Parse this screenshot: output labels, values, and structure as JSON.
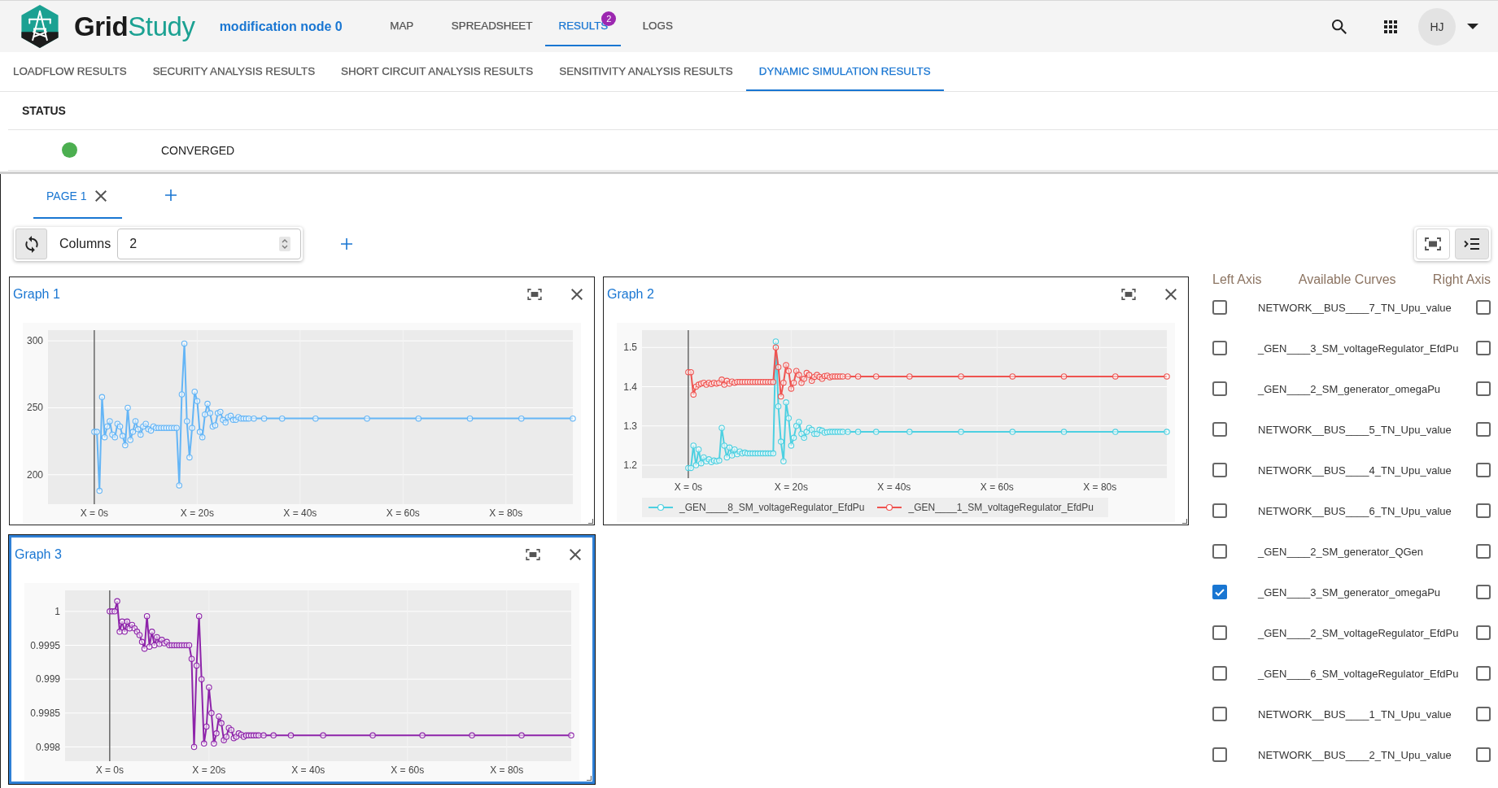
{
  "header": {
    "app_title": [
      "Grid",
      "Study"
    ],
    "study_name": "modification node 0",
    "nav_tabs": [
      {
        "label": "MAP",
        "selected": false
      },
      {
        "label": "SPREADSHEET",
        "selected": false
      },
      {
        "label": "RESULTS",
        "selected": true,
        "badge": "2"
      },
      {
        "label": "LOGS",
        "selected": false
      }
    ],
    "user_initials": "HJ"
  },
  "result_tabs": [
    {
      "label": "LOADFLOW RESULTS",
      "selected": false
    },
    {
      "label": "SECURITY ANALYSIS RESULTS",
      "selected": false
    },
    {
      "label": "SHORT CIRCUIT ANALYSIS RESULTS",
      "selected": false
    },
    {
      "label": "SENSITIVITY ANALYSIS RESULTS",
      "selected": false
    },
    {
      "label": "DYNAMIC SIMULATION RESULTS",
      "selected": true
    }
  ],
  "status_table": {
    "columns": [
      "STATUS"
    ],
    "rows": [
      {
        "color": "#4caf50",
        "status": "CONVERGED"
      }
    ]
  },
  "page_tabs": [
    {
      "label": "PAGE 1",
      "selected": true
    }
  ],
  "toolbar": {
    "columns_label": "Columns",
    "columns_value": "2"
  },
  "view_toggles": [
    {
      "kind": "fullscreen",
      "selected": false
    },
    {
      "kind": "curves",
      "selected": true
    }
  ],
  "graphs": [
    {
      "title": "Graph 1",
      "selected": false,
      "chart_data": {
        "type": "line",
        "grid": true,
        "x": [
          0,
          0.5,
          1,
          1.5,
          2,
          2.5,
          3,
          3.5,
          4,
          4.5,
          5,
          5.5,
          6,
          6.5,
          7,
          7.5,
          8,
          8.5,
          9,
          9.5,
          10,
          10.5,
          11,
          11.5,
          12,
          12.5,
          13,
          13.5,
          14,
          14.5,
          15,
          15.5,
          16,
          16.5,
          17,
          17.5,
          18,
          18.5,
          19,
          19.5,
          20,
          20.5,
          21,
          21.5,
          22,
          22.5,
          23,
          23.5,
          24,
          24.5,
          25,
          25.5,
          26,
          26.5,
          27,
          27.5,
          28,
          28.5,
          29,
          29.5,
          30,
          31,
          33,
          36.5,
          43,
          53,
          63,
          73,
          83,
          93
        ],
        "xlim": [
          -9,
          93
        ],
        "ylim": [
          178,
          308
        ],
        "xticks": [
          {
            "value": 0,
            "label": "X = 0s"
          },
          {
            "value": 20,
            "label": "X = 20s"
          },
          {
            "value": 40,
            "label": "X = 40s"
          },
          {
            "value": 60,
            "label": "X = 60s"
          },
          {
            "value": 80,
            "label": "X = 80s"
          }
        ],
        "yticks": [
          200,
          250,
          300
        ],
        "series": [
          {
            "color": "#64b5f6",
            "marker": "circle",
            "values": [
              232,
              232,
              188,
              258,
              228,
              236,
              240,
              230,
              228,
              238,
              236,
              229,
              222,
              250,
              226,
              232,
              240,
              234,
              230,
              236,
              238,
              234,
              233,
              236,
              235,
              235,
              235,
              235,
              235,
              235,
              235,
              235,
              235,
              192,
              260,
              298,
              240,
              213,
              235,
              262,
              255,
              232,
              228,
              245,
              253,
              246,
              236,
              237,
              246,
              247,
              241,
              239,
              243,
              244,
              241,
              241,
              243,
              242,
              242,
              242,
              242,
              242,
              242,
              242,
              242,
              242,
              242,
              242,
              242,
              242
            ]
          }
        ]
      }
    },
    {
      "title": "Graph 2",
      "selected": false,
      "chart_data": {
        "type": "line",
        "grid": true,
        "legend": "bottom",
        "x": [
          0,
          0.5,
          1,
          1.5,
          2,
          2.5,
          3,
          3.5,
          4,
          4.5,
          5,
          5.5,
          6,
          6.5,
          7,
          7.5,
          8,
          8.5,
          9,
          9.5,
          10,
          10.5,
          11,
          11.5,
          12,
          12.5,
          13,
          13.5,
          14,
          14.5,
          15,
          15.5,
          16,
          16.5,
          17,
          17.5,
          18,
          18.5,
          19,
          19.5,
          20,
          20.5,
          21,
          21.5,
          22,
          22.5,
          23,
          23.5,
          24,
          24.5,
          25,
          25.5,
          26,
          26.5,
          27,
          27.5,
          28,
          28.5,
          29,
          29.5,
          30,
          31,
          33,
          36.5,
          43,
          53,
          63,
          73,
          83,
          93
        ],
        "xlim": [
          -9,
          93
        ],
        "ylim": [
          1.167,
          1.544
        ],
        "xticks": [
          {
            "value": 0,
            "label": "X = 0s"
          },
          {
            "value": 20,
            "label": "X = 20s"
          },
          {
            "value": 40,
            "label": "X = 40s"
          },
          {
            "value": 60,
            "label": "X = 60s"
          },
          {
            "value": 80,
            "label": "X = 80s"
          }
        ],
        "yticks": [
          1.2,
          1.3,
          1.4,
          1.5
        ],
        "series": [
          {
            "name": "_GEN____8_SM_voltageRegulator_EfdPu",
            "color": "#4dd0e1",
            "marker": "circle",
            "values": [
              1.193,
              1.193,
              1.25,
              1.2,
              1.24,
              1.205,
              1.22,
              1.21,
              1.215,
              1.208,
              1.212,
              1.21,
              1.212,
              1.295,
              1.25,
              1.22,
              1.245,
              1.225,
              1.24,
              1.228,
              1.235,
              1.23,
              1.232,
              1.23,
              1.23,
              1.23,
              1.23,
              1.23,
              1.23,
              1.23,
              1.23,
              1.23,
              1.23,
              1.23,
              1.515,
              1.35,
              1.26,
              1.21,
              1.36,
              1.32,
              1.25,
              1.27,
              1.3,
              1.31,
              1.28,
              1.27,
              1.285,
              1.295,
              1.29,
              1.28,
              1.28,
              1.29,
              1.288,
              1.283,
              1.284,
              1.285,
              1.285,
              1.285,
              1.285,
              1.285,
              1.285,
              1.285,
              1.285,
              1.285,
              1.285,
              1.285,
              1.285,
              1.285,
              1.285,
              1.285
            ]
          },
          {
            "name": "_GEN____1_SM_voltageRegulator_EfdPu",
            "color": "#ef5350",
            "marker": "circle",
            "values": [
              1.437,
              1.437,
              1.38,
              1.4,
              1.405,
              1.408,
              1.41,
              1.405,
              1.41,
              1.407,
              1.41,
              1.408,
              1.41,
              1.418,
              1.405,
              1.415,
              1.408,
              1.413,
              1.41,
              1.412,
              1.412,
              1.412,
              1.412,
              1.412,
              1.412,
              1.412,
              1.412,
              1.412,
              1.412,
              1.412,
              1.412,
              1.412,
              1.412,
              1.412,
              1.5,
              1.45,
              1.375,
              1.41,
              1.455,
              1.44,
              1.395,
              1.41,
              1.44,
              1.43,
              1.41,
              1.42,
              1.435,
              1.43,
              1.415,
              1.425,
              1.43,
              1.425,
              1.42,
              1.427,
              1.428,
              1.424,
              1.426,
              1.426,
              1.426,
              1.426,
              1.426,
              1.426,
              1.426,
              1.426,
              1.426,
              1.426,
              1.426,
              1.426,
              1.426,
              1.426
            ]
          }
        ]
      }
    },
    {
      "title": "Graph 3",
      "selected": true,
      "chart_data": {
        "type": "line",
        "grid": true,
        "x": [
          0,
          0.5,
          1,
          1.5,
          2,
          2.5,
          3,
          3.5,
          4,
          4.5,
          5,
          5.5,
          6,
          6.5,
          7,
          7.5,
          8,
          8.5,
          9,
          9.5,
          10,
          10.5,
          11,
          11.5,
          12,
          12.5,
          13,
          13.5,
          14,
          14.5,
          15,
          15.5,
          16,
          16.5,
          17,
          17.5,
          18,
          18.5,
          19,
          19.5,
          20,
          20.5,
          21,
          21.5,
          22,
          22.5,
          23,
          23.5,
          24,
          24.5,
          25,
          25.5,
          26,
          26.5,
          27,
          27.5,
          28,
          28.5,
          29,
          29.5,
          30,
          31,
          33,
          36.5,
          43,
          53,
          63,
          73,
          83,
          93
        ],
        "xlim": [
          -9,
          93
        ],
        "ylim": [
          0.99779,
          1.00031
        ],
        "xticks": [
          {
            "value": 0,
            "label": "X = 0s"
          },
          {
            "value": 20,
            "label": "X = 20s"
          },
          {
            "value": 40,
            "label": "X = 40s"
          },
          {
            "value": 60,
            "label": "X = 60s"
          },
          {
            "value": 80,
            "label": "X = 80s"
          }
        ],
        "yticks": [
          0.998,
          0.9985,
          0.999,
          0.9995,
          1
        ],
        "series": [
          {
            "color": "#8e24aa",
            "marker": "circle",
            "values": [
              1,
              1,
              1,
              1.00015,
              0.9997,
              0.99985,
              0.9997,
              0.99985,
              0.99975,
              0.9998,
              0.99975,
              0.9997,
              0.99965,
              0.99955,
              0.99945,
              0.99993,
              0.99948,
              0.9997,
              0.9995,
              0.99962,
              0.99952,
              0.99958,
              0.99953,
              0.99955,
              0.9995,
              0.9995,
              0.9995,
              0.9995,
              0.9995,
              0.9995,
              0.9995,
              0.9995,
              0.9995,
              0.9993,
              0.998,
              0.9992,
              0.99993,
              0.999,
              0.99805,
              0.9983,
              0.99888,
              0.9985,
              0.99805,
              0.9982,
              0.99845,
              0.99835,
              0.9981,
              0.99815,
              0.99828,
              0.99825,
              0.99813,
              0.99815,
              0.9982,
              0.99818,
              0.99815,
              0.99817,
              0.99817,
              0.99817,
              0.99817,
              0.99817,
              0.99817,
              0.99817,
              0.99817,
              0.99817,
              0.99817,
              0.99817,
              0.99817,
              0.99817,
              0.99817,
              0.99817
            ]
          }
        ]
      }
    }
  ],
  "curves_panel": {
    "headers": [
      "Left Axis",
      "Available Curves",
      "Right Axis"
    ],
    "curves": [
      {
        "name": "NETWORK__BUS____7_TN_Upu_value",
        "left_axis": false,
        "right_axis": false
      },
      {
        "name": "_GEN____3_SM_voltageRegulator_EfdPu",
        "left_axis": false,
        "right_axis": false
      },
      {
        "name": "_GEN____2_SM_generator_omegaPu",
        "left_axis": false,
        "right_axis": false
      },
      {
        "name": "NETWORK__BUS____5_TN_Upu_value",
        "left_axis": false,
        "right_axis": false
      },
      {
        "name": "NETWORK__BUS____4_TN_Upu_value",
        "left_axis": false,
        "right_axis": false
      },
      {
        "name": "NETWORK__BUS____6_TN_Upu_value",
        "left_axis": false,
        "right_axis": false
      },
      {
        "name": "_GEN____2_SM_generator_QGen",
        "left_axis": false,
        "right_axis": false
      },
      {
        "name": "_GEN____3_SM_generator_omegaPu",
        "left_axis": true,
        "right_axis": false
      },
      {
        "name": "_GEN____2_SM_voltageRegulator_EfdPu",
        "left_axis": false,
        "right_axis": false
      },
      {
        "name": "_GEN____6_SM_voltageRegulator_EfdPu",
        "left_axis": false,
        "right_axis": false
      },
      {
        "name": "NETWORK__BUS____1_TN_Upu_value",
        "left_axis": false,
        "right_axis": false
      },
      {
        "name": "NETWORK__BUS____2_TN_Upu_value",
        "left_axis": false,
        "right_axis": false
      }
    ]
  }
}
